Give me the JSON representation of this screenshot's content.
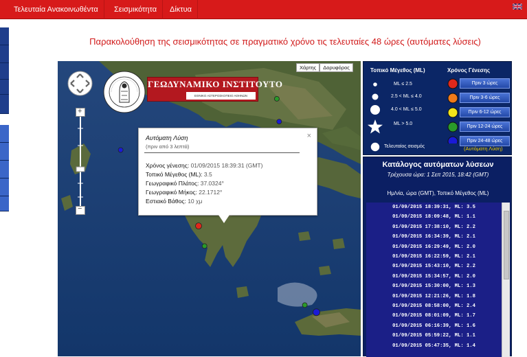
{
  "nav": {
    "items": [
      "Τελευταία Ανακοινωθέντα",
      "Σεισμικότητα",
      "Δίκτυα"
    ],
    "flag_icon": "uk-flag-icon"
  },
  "page_title": "Παρακολούθηση της σεισμικότητας σε πραγματικό χρόνο τις τελευταίες 48 ώρες (αυτόματες λύσεις)",
  "map": {
    "type_buttons": [
      "Χάρτης",
      "Δορυφόρος"
    ],
    "logo_title": "ΓΕΩΔΥΝΑΜΙΚΟ ΙΝΣΤΙΤΟΥΤΟ",
    "logo_subtitle": "ΕΘΝΙΚΟ ΑΣΤΕΡΟΣΚΟΠΕΙΟ ΑΘΗΝΩΝ",
    "zoom_in": "+",
    "zoom_out": "−"
  },
  "info_window": {
    "title": "Αυτόματη Λύση",
    "subtitle": "(πριν από 3 λεπτά)",
    "close": "×",
    "rows": [
      {
        "label": "Χρόνος γένεσης:",
        "value": "01/09/2015 18:39:31 (GMT)"
      },
      {
        "label": "Τοπικό Μέγεθος (ML):",
        "value": "3.5"
      },
      {
        "label": "Γεωγραφικό Πλάτος:",
        "value": "37.0324°"
      },
      {
        "label": "Γεωγραφικό Μήκος:",
        "value": "22.1712°"
      },
      {
        "label": "Εστιακό Βάθος:",
        "value": "10 χμ"
      }
    ]
  },
  "legend": {
    "magnitude_head": "Τοπικό Μέγεθος (ML)",
    "time_head": "Χρόνος Γένεσης",
    "magnitudes": [
      "ML ≤ 2.5",
      "2.5 < ML ≤ 4.0",
      "4.0 < ML ≤ 5.0",
      "ML > 5.0",
      "Τελευταίος σεισμός"
    ],
    "times": [
      {
        "label": "Πριν 3 ώρες",
        "color": "#e0281b"
      },
      {
        "label": "Πριν 3-6 ώρες",
        "color": "#f07a1a"
      },
      {
        "label": "Πριν 6-12 ώρες",
        "color": "#f3e41a"
      },
      {
        "label": "Πριν 12-24 ώρες",
        "color": "#2a9a2a"
      },
      {
        "label": "Πριν 24-48 ώρες",
        "color": "#1a1ad6"
      }
    ],
    "auto_label": "(Αυτόματη Λύση)"
  },
  "catalog": {
    "title": "Κατάλογος αυτόματων λύσεων",
    "current_time": "Τρέχουσα ώρα: 1 Σεπ 2015, 18:42 (GMT)",
    "header": "Ημ/νία, ώρα (GMT), Τοπικό Μέγεθος (ML)",
    "rows": [
      "01/09/2015 18:39:31, ML: 3.5",
      "01/09/2015 18:09:48, ML: 1.1",
      "01/09/2015 17:38:10, ML: 2.2",
      "01/09/2015 16:34:39, ML: 2.1",
      "01/09/2015 16:29:49, ML: 2.0",
      "01/09/2015 16:22:59, ML: 2.1",
      "01/09/2015 15:43:10, ML: 2.2",
      "01/09/2015 15:34:57, ML: 2.0",
      "01/09/2015 15:30:00, ML: 1.3",
      "01/09/2015 12:21:26, ML: 1.8",
      "01/09/2015 08:58:00, ML: 2.4",
      "01/09/2015 08:01:09, ML: 1.7",
      "01/09/2015 06:16:39, ML: 1.6",
      "01/09/2015 05:59:22, ML: 1.1",
      "01/09/2015 05:47:35, ML: 1.4"
    ]
  },
  "quake_markers": [
    {
      "lon": 22.1712,
      "lat": 37.0324,
      "color": "#e0281b",
      "latest": true
    },
    {
      "lon": 22.3,
      "lat": 36.75,
      "color": "#2a9a2a",
      "latest": false
    },
    {
      "lon": 24.7,
      "lat": 35.82,
      "color": "#1a1ad6",
      "latest": false
    },
    {
      "lon": 24.45,
      "lat": 35.92,
      "color": "#2a9a2a",
      "latest": false
    },
    {
      "lon": 21.3,
      "lat": 38.95,
      "color": "#1a1ad6",
      "latest": false
    },
    {
      "lon": 22.0,
      "lat": 38.93,
      "color": "#e0281b",
      "latest": false
    },
    {
      "lon": 23.85,
      "lat": 38.82,
      "color": "#2a9a2a",
      "latest": false
    },
    {
      "lon": 20.5,
      "lat": 38.1,
      "color": "#1a1ad6",
      "latest": false
    },
    {
      "lon": 24.25,
      "lat": 38.35,
      "color": "#1a1ad6",
      "latest": false
    },
    {
      "lon": 23.9,
      "lat": 38.5,
      "color": "#1a1ad6",
      "latest": false
    }
  ]
}
